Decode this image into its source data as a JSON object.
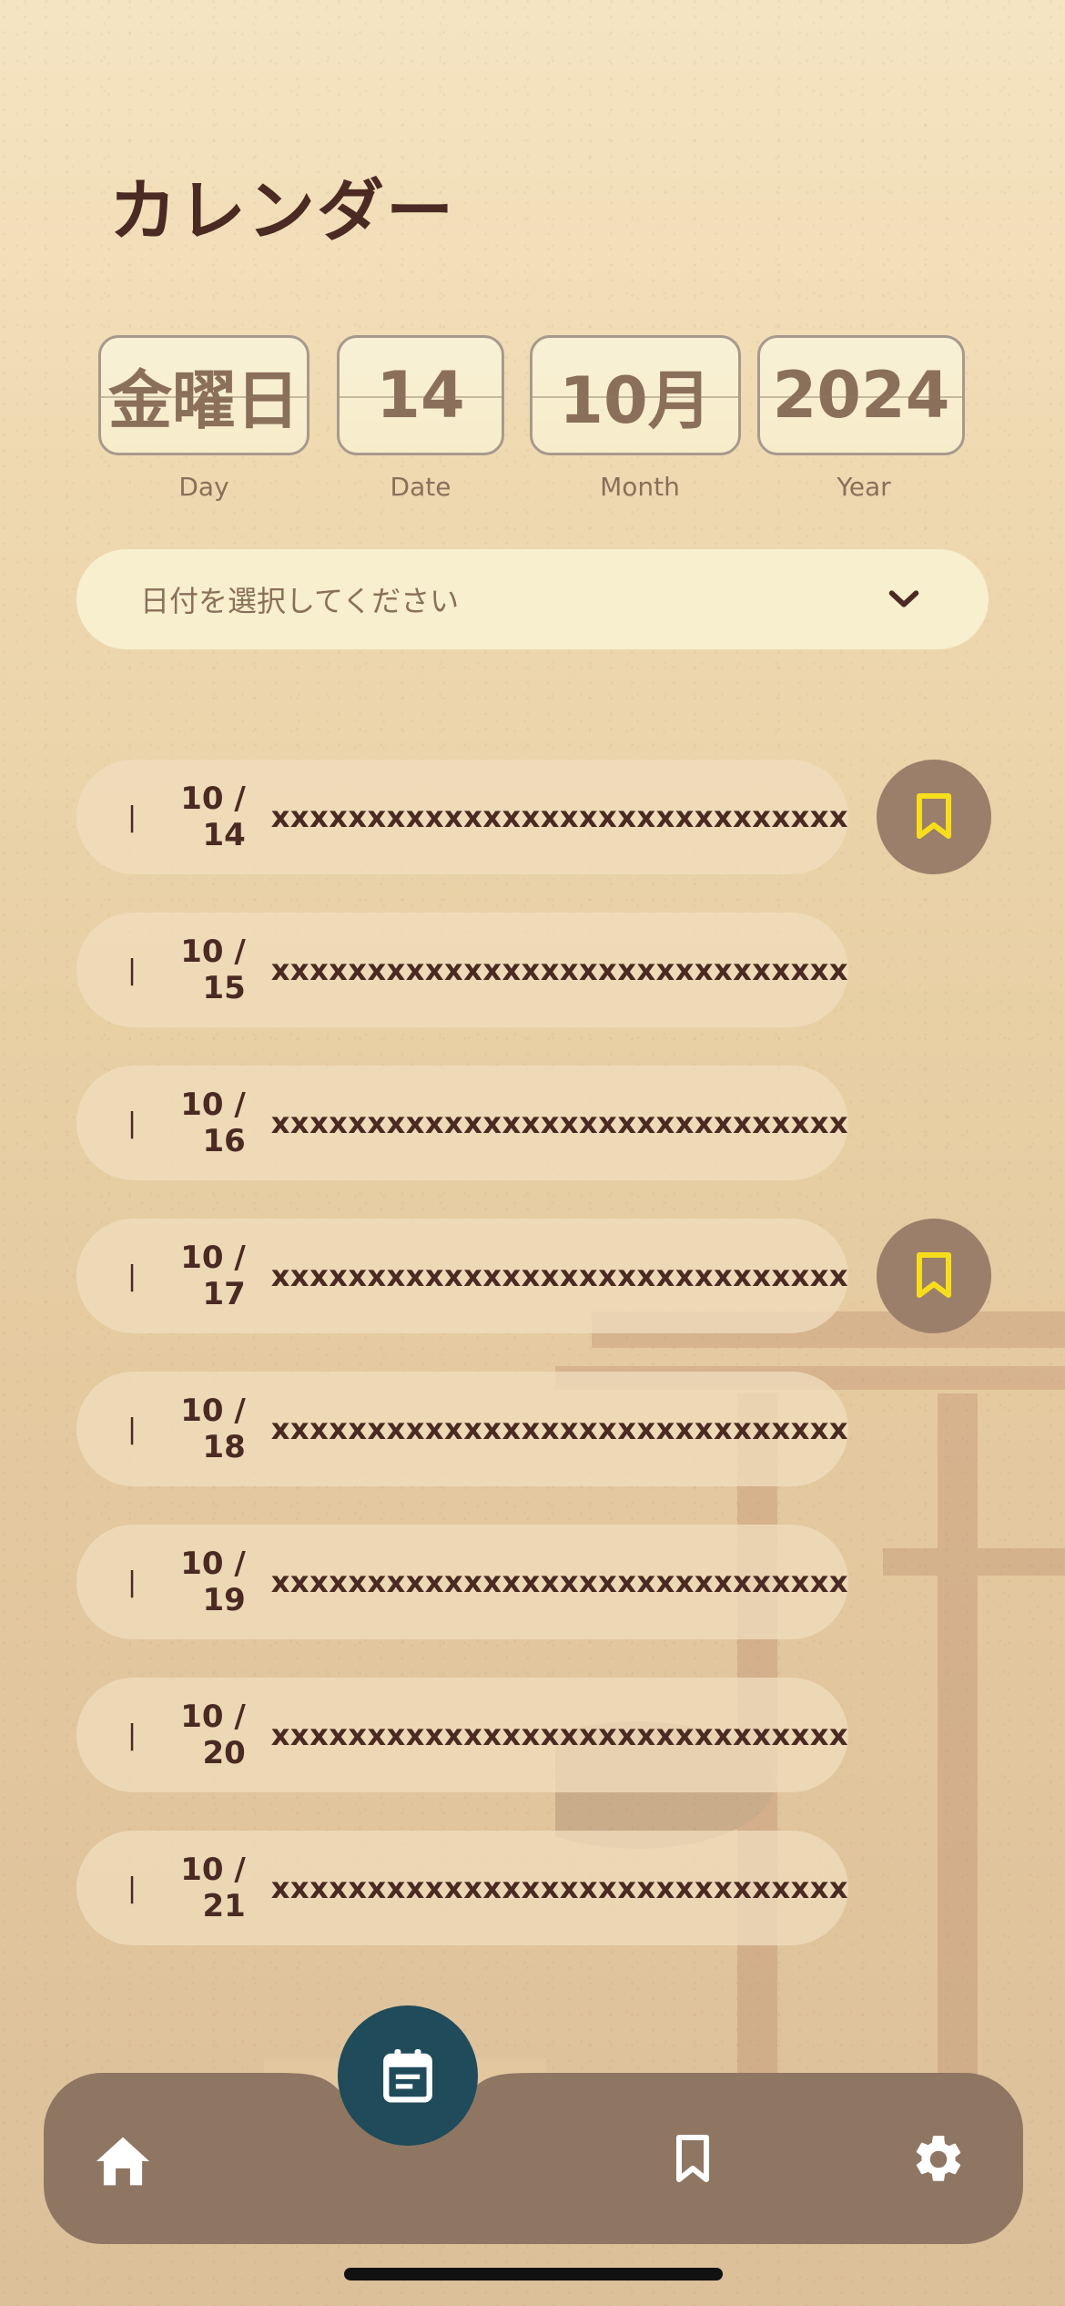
{
  "header": {
    "title": "カレンダー"
  },
  "date_display": {
    "day": {
      "value": "金曜日",
      "label": "Day"
    },
    "date": {
      "value": "14",
      "label": "Date"
    },
    "month": {
      "value": "10月",
      "label": "Month"
    },
    "year": {
      "value": "2024",
      "label": "Year"
    }
  },
  "date_select": {
    "placeholder": "日付を選択してください",
    "icon": "chevron-down-icon"
  },
  "entries": [
    {
      "separator": "|",
      "date": "10 / 14",
      "text": "xxxxxxxxxxxxxxxxxxxxxxxxxxxxxx",
      "bookmarked": true
    },
    {
      "separator": "|",
      "date": "10 / 15",
      "text": "xxxxxxxxxxxxxxxxxxxxxxxxxxxxxx",
      "bookmarked": false
    },
    {
      "separator": "|",
      "date": "10 / 16",
      "text": "xxxxxxxxxxxxxxxxxxxxxxxxxxxxxx",
      "bookmarked": false
    },
    {
      "separator": "|",
      "date": "10 / 17",
      "text": "xxxxxxxxxxxxxxxxxxxxxxxxxxxxxx",
      "bookmarked": true
    },
    {
      "separator": "|",
      "date": "10 / 18",
      "text": "xxxxxxxxxxxxxxxxxxxxxxxxxxxxxx",
      "bookmarked": false
    },
    {
      "separator": "|",
      "date": "10 / 19",
      "text": "xxxxxxxxxxxxxxxxxxxxxxxxxxxxxx",
      "bookmarked": false
    },
    {
      "separator": "|",
      "date": "10 / 20",
      "text": "xxxxxxxxxxxxxxxxxxxxxxxxxxxxxx",
      "bookmarked": false
    },
    {
      "separator": "|",
      "date": "10 / 21",
      "text": "xxxxxxxxxxxxxxxxxxxxxxxxxxxxxx",
      "bookmarked": false
    }
  ],
  "bottom_nav": {
    "items": [
      {
        "icon": "home-icon"
      },
      {
        "icon": "calendar-icon",
        "active": true
      },
      {
        "icon": "bookmark-icon"
      },
      {
        "icon": "gear-icon"
      }
    ]
  },
  "colors": {
    "text_dark": "#4a2a22",
    "text_muted": "#8a6f5a",
    "bookmark_yellow": "#f7de1c",
    "nav_bar": "#8f7663",
    "fab": "#204b5b"
  }
}
